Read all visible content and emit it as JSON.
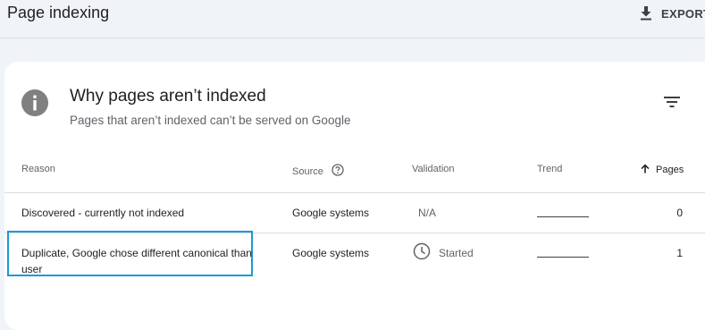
{
  "header": {
    "title": "Page indexing",
    "export_label": "EXPORT"
  },
  "card": {
    "title": "Why pages aren’t indexed",
    "subtitle": "Pages that aren’t indexed can’t be served on Google"
  },
  "table": {
    "columns": {
      "reason": "Reason",
      "source": "Source",
      "validation": "Validation",
      "trend": "Trend",
      "pages": "Pages"
    },
    "sort": {
      "column": "pages",
      "direction": "ascending"
    },
    "rows": [
      {
        "reason": "Discovered - currently not indexed",
        "source": "Google systems",
        "validation": "N/A",
        "validation_icon": "",
        "pages": "0"
      },
      {
        "reason": "Duplicate, Google chose different canonical than user",
        "source": "Google systems",
        "validation": "Started",
        "validation_icon": "clock-icon",
        "pages": "1",
        "highlight_color": "#1a9bd7"
      }
    ]
  },
  "icons": {
    "export": "download-icon",
    "info": "info-icon",
    "filter": "filter-icon",
    "help": "help-circle-icon",
    "sort": "arrow-up-icon"
  },
  "colors": {
    "page_background": "#f0f4f9",
    "card_background": "#ffffff",
    "info_icon": "#808080",
    "highlight_border": "#1a9bd7"
  }
}
